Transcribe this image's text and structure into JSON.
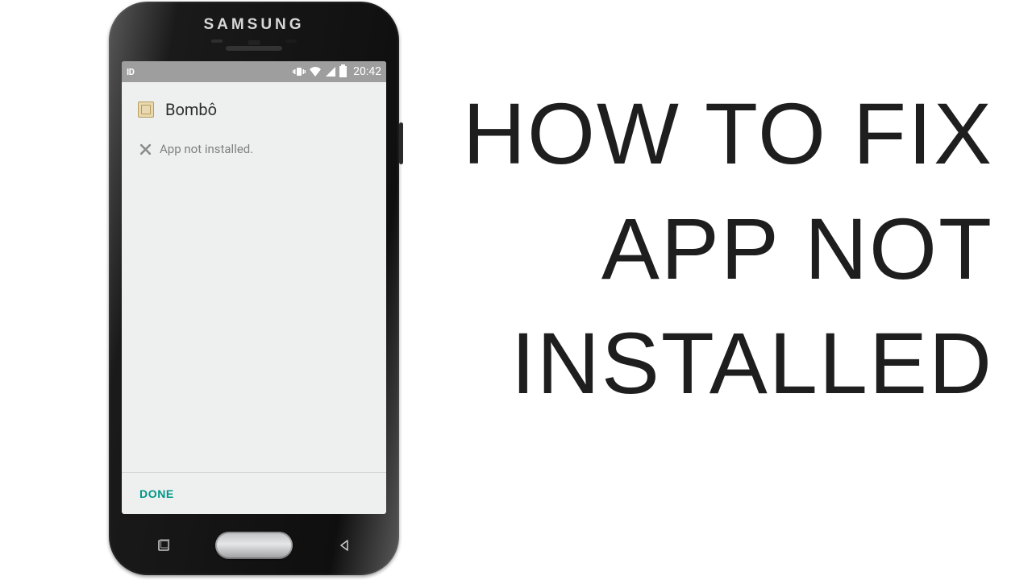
{
  "headline": {
    "line1": "HOW TO FIX",
    "line2": "APP NOT",
    "line3": "INSTALLED"
  },
  "phone": {
    "brand": "SAMSUNG",
    "statusbar": {
      "left_badge": "ID",
      "time": "20:42",
      "icons": {
        "vibrate": "vibrate-icon",
        "wifi": "wifi-icon",
        "cell": "cell-signal-icon",
        "battery": "battery-icon"
      }
    },
    "installer": {
      "app_name": "Bombô",
      "error_message": "App not installed.",
      "done_label": "DONE"
    },
    "nav": {
      "recent": "recent-apps-icon",
      "home": "home-button",
      "back": "back-icon"
    }
  }
}
